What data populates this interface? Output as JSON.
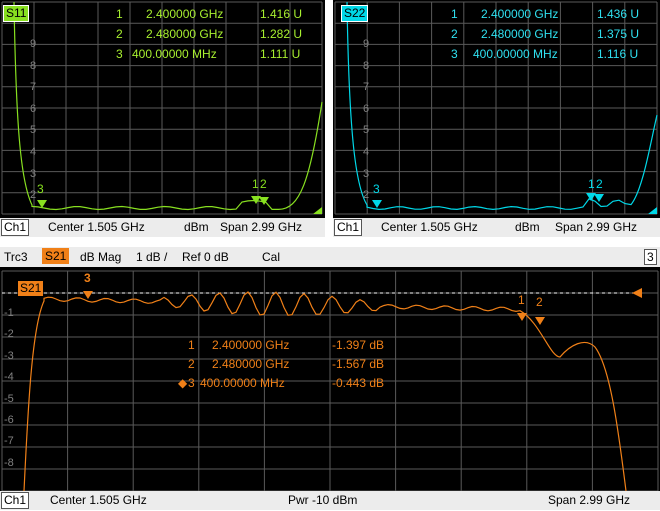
{
  "s11": {
    "trace": "S11",
    "markers": [
      {
        "n": "1",
        "freq": "2.400000 GHz",
        "val": "1.416 U"
      },
      {
        "n": "2",
        "freq": "2.480000 GHz",
        "val": "1.282 U"
      },
      {
        "n": "3",
        "freq": "400.00000 MHz",
        "val": "1.111 U"
      }
    ],
    "y_labels": [
      "9",
      "8",
      "7",
      "6",
      "5",
      "4",
      "3",
      "2"
    ],
    "footer": {
      "channel": "Ch1",
      "center": "Center  1.505 GHz",
      "mid": "dBm",
      "span": "Span  2.99 GHz"
    },
    "color": "#88e020"
  },
  "s22": {
    "trace": "S22",
    "markers": [
      {
        "n": "1",
        "freq": "2.400000 GHz",
        "val": "1.436 U"
      },
      {
        "n": "2",
        "freq": "2.480000 GHz",
        "val": "1.375 U"
      },
      {
        "n": "3",
        "freq": "400.00000 MHz",
        "val": "1.116 U"
      }
    ],
    "y_labels": [
      "9",
      "8",
      "7",
      "6",
      "5",
      "4",
      "3",
      "2"
    ],
    "footer": {
      "channel": "Ch1",
      "center": "Center  1.505 GHz",
      "mid": "dBm",
      "span": "Span  2.99 GHz"
    },
    "color": "#00d8e8"
  },
  "s21": {
    "header": {
      "trc": "Trc3",
      "trace": "S21",
      "format": "dB Mag",
      "scale": "1 dB /",
      "ref": "Ref 0 dB",
      "cal": "Cal",
      "num": "3"
    },
    "trace": "S21",
    "markers": [
      {
        "n": "1",
        "freq": "2.400000 GHz",
        "val": "-1.397 dB"
      },
      {
        "n": "2",
        "freq": "2.480000 GHz",
        "val": "-1.567 dB"
      },
      {
        "n": "3",
        "freq": "400.00000 MHz",
        "val": "-0.443 dB"
      }
    ],
    "marker_tags": {
      "m1": "1",
      "m2": "2",
      "m3": "3"
    },
    "y_labels": [
      "-1",
      "-2",
      "-3",
      "-4",
      "-5",
      "-6",
      "-7",
      "-8"
    ],
    "footer": {
      "channel": "Ch1",
      "center": "Center  1.505 GHz",
      "pwr": "Pwr -10 dBm",
      "span": "Span  2.99 GHz"
    },
    "color": "#f08018"
  }
}
